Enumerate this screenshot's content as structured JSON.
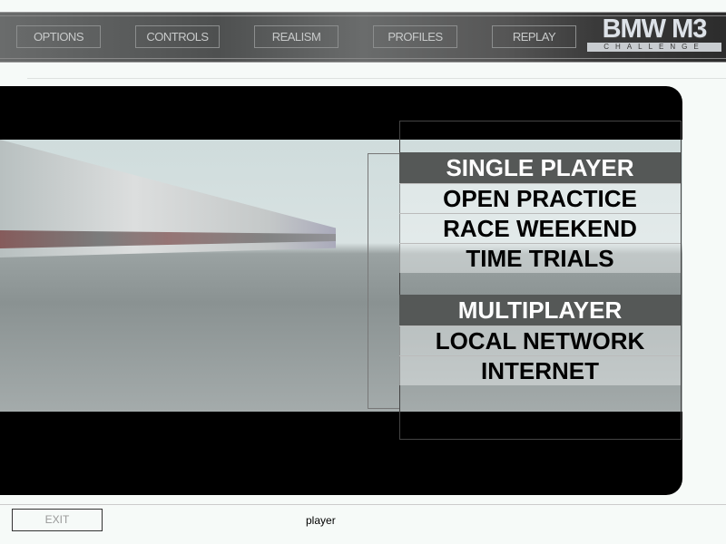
{
  "top_nav": {
    "items": [
      "OPTIONS",
      "CONTROLS",
      "REALISM",
      "PROFILES",
      "REPLAY"
    ]
  },
  "logo": {
    "title": "BMW M3",
    "subtitle": "CHALLENGE"
  },
  "menu": {
    "single_player": {
      "header": "SINGLE PLAYER",
      "items": [
        "OPEN PRACTICE",
        "RACE WEEKEND",
        "TIME TRIALS"
      ]
    },
    "multiplayer": {
      "header": "MULTIPLAYER",
      "items": [
        "LOCAL NETWORK",
        "INTERNET"
      ]
    }
  },
  "footer": {
    "exit_label": "EXIT",
    "status": "player"
  }
}
